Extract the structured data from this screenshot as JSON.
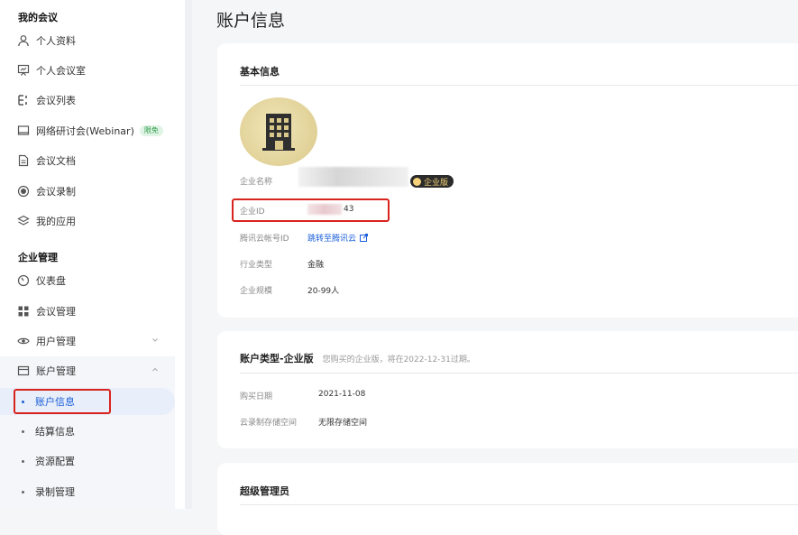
{
  "sidebar": {
    "section_meetings": "我的会议",
    "meeting_items": [
      {
        "label": "个人资料",
        "icon": "user-icon"
      },
      {
        "label": "个人会议室",
        "icon": "presentation-icon"
      },
      {
        "label": "会议列表",
        "icon": "list-icon"
      },
      {
        "label": "网络研讨会(Webinar)",
        "icon": "monitor-icon",
        "badge": "限免"
      },
      {
        "label": "会议文档",
        "icon": "document-icon"
      },
      {
        "label": "会议录制",
        "icon": "record-icon"
      },
      {
        "label": "我的应用",
        "icon": "layers-icon"
      }
    ],
    "section_enterprise": "企业管理",
    "enterprise_items": [
      {
        "label": "仪表盘",
        "icon": "dashboard-icon"
      },
      {
        "label": "会议管理",
        "icon": "grid-icon"
      },
      {
        "label": "用户管理",
        "icon": "eye-icon"
      },
      {
        "label": "账户管理",
        "icon": "account-icon"
      }
    ],
    "account_sub_items": [
      {
        "label": "账户信息",
        "active": true
      },
      {
        "label": "结算信息"
      },
      {
        "label": "资源配置"
      },
      {
        "label": "录制管理"
      }
    ]
  },
  "page": {
    "title": "账户信息"
  },
  "basic": {
    "title": "基本信息",
    "name_label": "企业名称",
    "edition_badge": "企业版",
    "id_label": "企业ID",
    "id_value_suffix": "43",
    "cloud_label": "腾讯云帐号ID",
    "cloud_link": "跳转至腾讯云",
    "industry_label": "行业类型",
    "industry_value": "金融",
    "scale_label": "企业规模",
    "scale_value": "20-99人"
  },
  "account_type": {
    "title": "账户类型-企业版",
    "subtitle": "您购买的企业版，将在2022-12-31过期。",
    "purchase_label": "购买日期",
    "purchase_value": "2021-11-08",
    "storage_label": "云录制存储空间",
    "storage_value": "无限存储空间"
  },
  "super_admin": {
    "title": "超级管理员"
  },
  "colors": {
    "accent": "#1a5ed8",
    "highlight_box": "#d9231d",
    "badge_gold": "#f5d27a"
  }
}
